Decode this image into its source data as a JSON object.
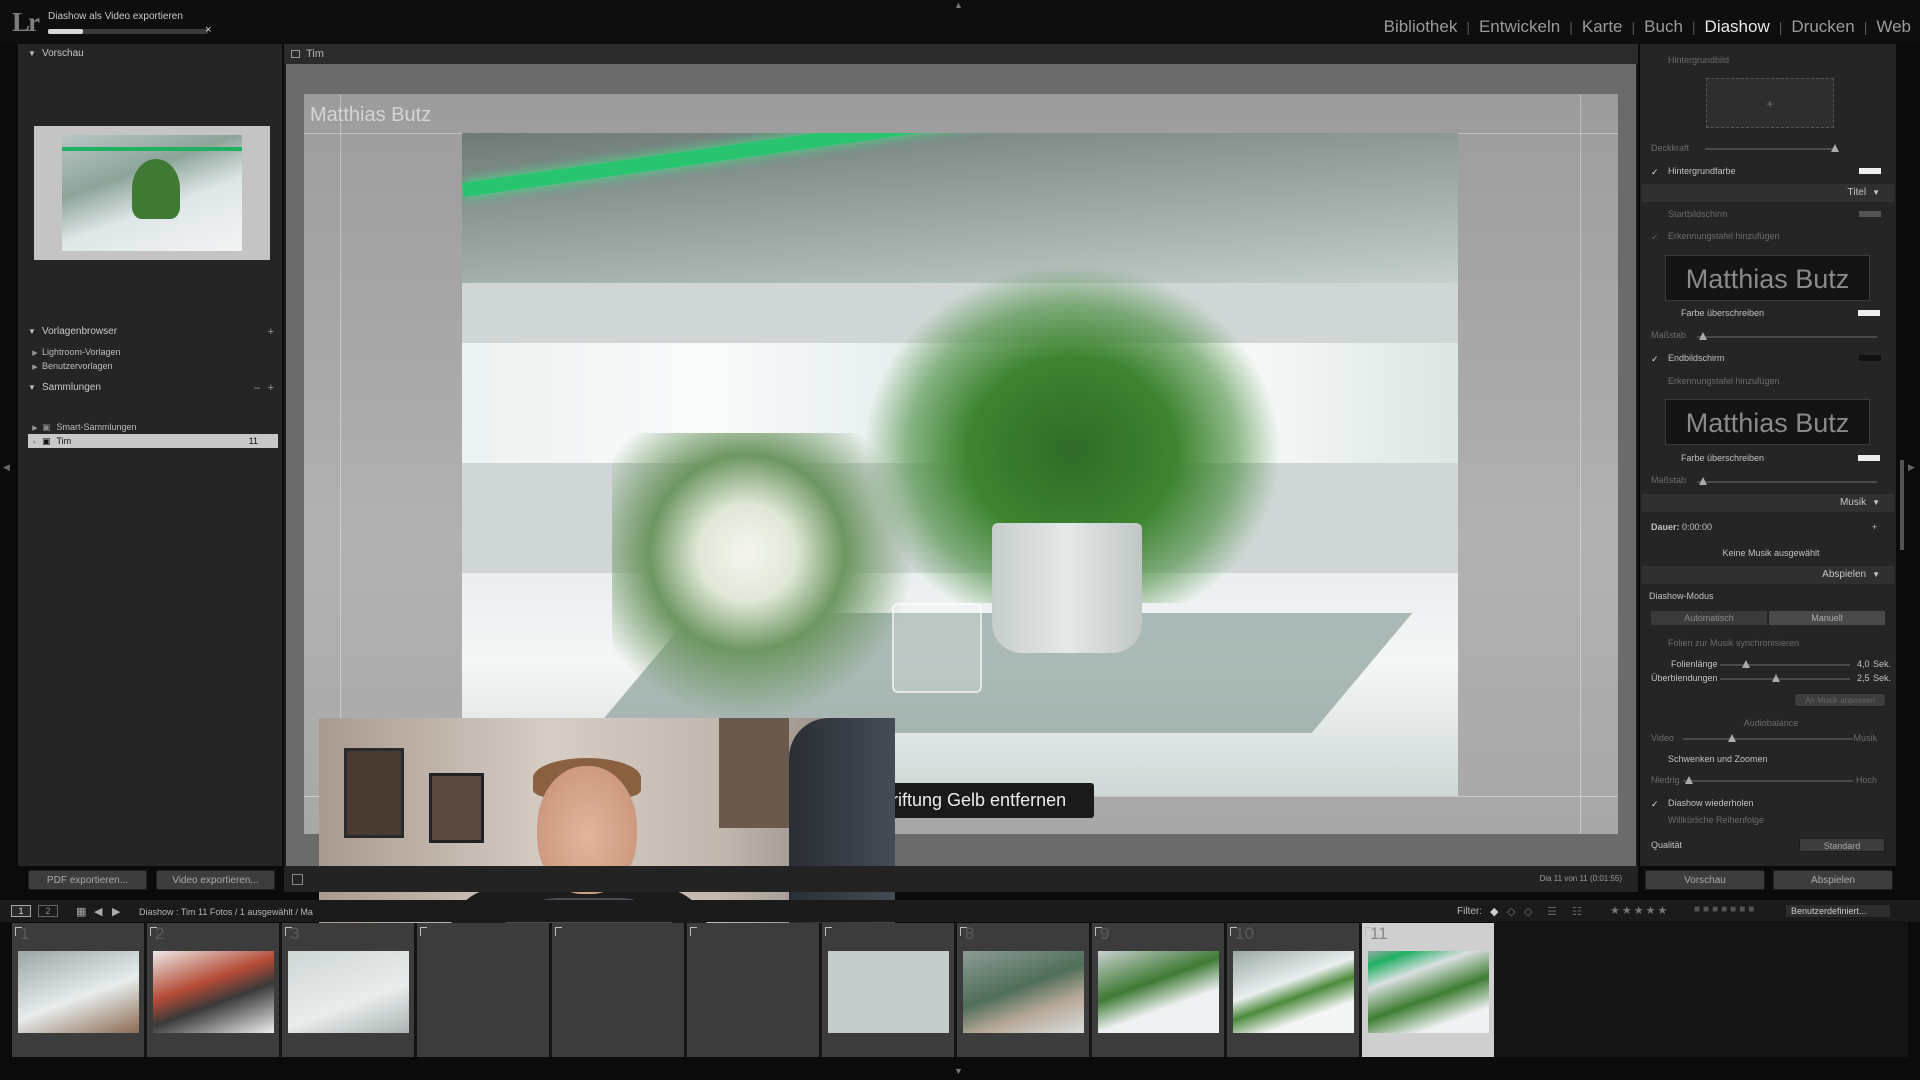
{
  "topbar": {
    "logo": "Lr",
    "progress": {
      "title": "Diashow als Video exportieren",
      "fraction": 0.22,
      "close": "×"
    },
    "modules": [
      "Bibliothek",
      "Entwickeln",
      "Karte",
      "Buch",
      "Diashow",
      "Drucken",
      "Web"
    ],
    "active_module": "Diashow",
    "separator": "|"
  },
  "left_panel": {
    "preview": {
      "header": "Vorschau"
    },
    "template_browser": {
      "header": "Vorlagenbrowser",
      "plus": "+",
      "items": [
        "Lightroom-Vorlagen",
        "Benutzervorlagen"
      ]
    },
    "collections": {
      "header": "Sammlungen",
      "minus": "–",
      "plus": "+",
      "items": [
        {
          "label": "Smart-Sammlungen",
          "count": ""
        },
        {
          "label": "Tim",
          "count": "11"
        }
      ]
    },
    "buttons": {
      "export_pdf": "PDF exportieren...",
      "export_video": "Video exportieren..."
    }
  },
  "center": {
    "header": "Tim",
    "slide_title": "Matthias Butz",
    "caption": "riftung Gelb entfernen",
    "slide_info": "Dia 11 von 11 (0:01:55)"
  },
  "right_panel": {
    "background_image": "Hintergrundbild",
    "opacity": "Deckkraft",
    "background_color": "Hintergrundfarbe",
    "titles_section": "Titel",
    "intro_screen": "Startbildschirm",
    "add_id_plate": "Erkennungstafel hinzufügen",
    "id_plate_text": "Matthias Butz",
    "override_color": "Farbe überschreiben",
    "scale": "Maßstab",
    "ending_screen": "Endbildschirm",
    "add_id_plate_2": "Erkennungstafel hinzufügen",
    "id_plate_text_2": "Matthias Butz",
    "override_color_2": "Farbe überschreiben",
    "scale_2": "Maßstab",
    "music_section": "Musik",
    "duration_label": "Dauer:",
    "duration_value": "0:00:00",
    "no_music": "Keine Musik ausgewählt",
    "playback_section": "Abspielen",
    "slideshow_mode": "Diashow-Modus",
    "mode_auto": "Automatisch",
    "mode_manual": "Manuell",
    "sync_music": "Folien zur Musik synchronisieren",
    "slide_length_label": "Folienlänge",
    "slide_length_value": "4,0",
    "slide_length_unit": "Sek.",
    "transitions_label": "Überblendungen",
    "transitions_value": "2,5",
    "transitions_unit": "Sek.",
    "fit_to_music": "An Musik anpassen",
    "audio_balance": "Audiobalance",
    "video_label": "Video",
    "music_label": "Musik",
    "pan_zoom": "Schwenken und Zoomen",
    "low": "Niedrig",
    "high": "Hoch",
    "repeat": "Diashow wiederholen",
    "random_order": "Willkürliche Reihenfolge",
    "quality_label": "Qualität",
    "quality_value": "Standard",
    "preview_button": "Vorschau",
    "play_button": "Abspielen",
    "check": "✓",
    "section_toggle": "▼",
    "plus": "+"
  },
  "filmstrip": {
    "monitor_1": "1",
    "monitor_2": "2",
    "path": "Diashow : Tim   11 Fotos / 1 ausgewählt / Ma",
    "filter_label": "Filter:",
    "filter_value": "Benutzerdefiniert...",
    "cells": [
      {
        "num": "1"
      },
      {
        "num": "2"
      },
      {
        "num": "3"
      },
      {
        "num": ""
      },
      {
        "num": ""
      },
      {
        "num": ""
      },
      {
        "num": ""
      },
      {
        "num": "8"
      },
      {
        "num": "9"
      },
      {
        "num": "10"
      },
      {
        "num": "11"
      }
    ],
    "selected_index": 10
  },
  "colors": {
    "accent_green": "#28c46f",
    "panel": "#252525",
    "selected_cell": "#cfcfcf"
  }
}
